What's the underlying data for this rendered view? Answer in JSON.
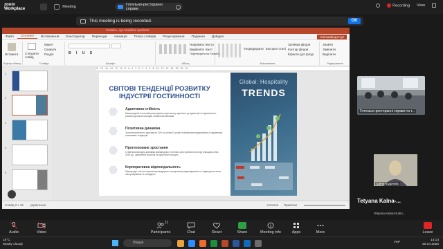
{
  "zoom": {
    "logo_line1": "zoom",
    "logo_line2": "Workplace",
    "meeting_label": "Meeting",
    "share_label": "Готельно-ресторанні справи",
    "recording_label": "Recording",
    "view_label": "View",
    "notice_text": "This meeting is being recorded.",
    "ok_label": "OK"
  },
  "ppt": {
    "tabs": [
      "Файл",
      "Основне",
      "Вставлення",
      "Конструктор",
      "Переходи",
      "Анімація",
      "Показ слайдів",
      "Рецензування",
      "Подання",
      "Довідка"
    ],
    "active_tab": "Основне",
    "title_hint": "Скажіть, що потрібно зробити",
    "share_label": "Спільний доступ",
    "ribbon": {
      "paste": "Вставити",
      "create_slide": "Створити слайд",
      "layout": "Макет",
      "reset": "Скинути",
      "section": "Розділ",
      "clipboard_group": "Буфер обміну",
      "slides_group": "Слайди",
      "font_group": "Шрифт",
      "paragraph_group": "Абзац",
      "drawing_group": "Малювання",
      "editing_group": "Редагування",
      "text_direction": "Напрямок тексту",
      "align_text": "Вирівняти текст",
      "convert_smartart": "Перетворити на SmartArt",
      "arrange": "Упорядкувати",
      "quick_styles": "Експрес-стилі",
      "shape_fill": "Заливка фігури",
      "shape_outline": "Контур фігури",
      "shape_effects": "Ефекти для фігур",
      "find": "Знайти",
      "replace": "Замінити",
      "select": "Виділити"
    },
    "slide_numbers": [
      "1",
      "2",
      "3",
      "4",
      "5"
    ],
    "status_left": "Слайд 2 з 15",
    "status_lang": "українська",
    "notes_label": "Нотатки",
    "comments_label": "Примітки"
  },
  "slide": {
    "title": "СВІТОВІ ТЕНДЕНЦІЇ РОЗВИТКУ ІНДУСТРІЇ ГОСТИННОСТІ",
    "right_title_1": "Global: Hospitality",
    "right_title_2": "TRENDS",
    "items": [
      {
        "heading": "Адаптивна стійкість",
        "text": "Міжнародний готельний ринок демонструє високу здатність до адаптації та відновлення, успішно долаючи наслідки глобальних викликів."
      },
      {
        "heading": "Позитивна динаміка",
        "text": "Зростання виїзного туризму на 11% за останні 5 років та ефективне відновлення є свідченням позитивних тенденцій."
      },
      {
        "heading": "Прогнозоване зростання",
        "text": "Стабільна висхідна динаміка міжнародного готельно-ресторанного сектору впродовж 2024-2028 рр., зумовлена попитом на туристичні послуги."
      },
      {
        "heading": "Корпоративна відповідальність",
        "text": "Міжнародні готельні мережі впроваджують корпоративну відповідальність, підвищуючи якість обслуговування та стандарти."
      }
    ]
  },
  "gallery": {
    "room_label": "Готельно-ресторанні справи та т...",
    "person_label": "Ірина Кудряєва",
    "speaker_big": "Tetyana  Kalna-...",
    "speaker_small": "Tetyana Kalna-Dubin..."
  },
  "toolbar": {
    "audio": "Audio",
    "video": "Video",
    "participants": "Participants",
    "participants_count": "11",
    "chat": "Chat",
    "react": "React",
    "share": "Share",
    "meeting_info": "Meeting info",
    "apps": "Apps",
    "more": "More",
    "leave": "Leave"
  },
  "taskbar": {
    "temp": "18°C",
    "weather": "Mostly cloudy",
    "search": "Пошук",
    "lang": "УКР",
    "time": "14:14",
    "date": "30.04.2025"
  },
  "colors": {
    "ppt_accent": "#b7472a",
    "slide_title": "#2c4f8f",
    "zoom_blue": "#0e71eb",
    "share_green": "#2ea043",
    "leave_red": "#e02424"
  }
}
